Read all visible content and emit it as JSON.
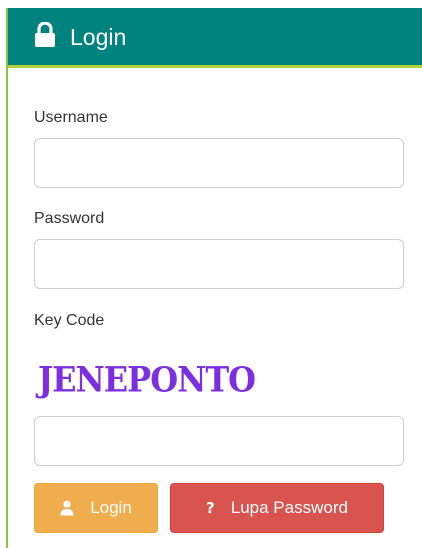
{
  "header": {
    "title": "Login",
    "icon": "lock-icon",
    "color": "#00827f",
    "accent": "#b3d236"
  },
  "form": {
    "username_label": "Username",
    "username_value": "",
    "password_label": "Password",
    "password_value": "",
    "keycode_label": "Key Code",
    "captcha_text": "JENEPONTO",
    "keycode_value": ""
  },
  "buttons": {
    "login_label": "Login",
    "login_icon": "user-icon",
    "login_color": "#f0ad4e",
    "lupa_label": "Lupa Password",
    "lupa_icon": "question-icon",
    "lupa_color": "#d9534f"
  }
}
